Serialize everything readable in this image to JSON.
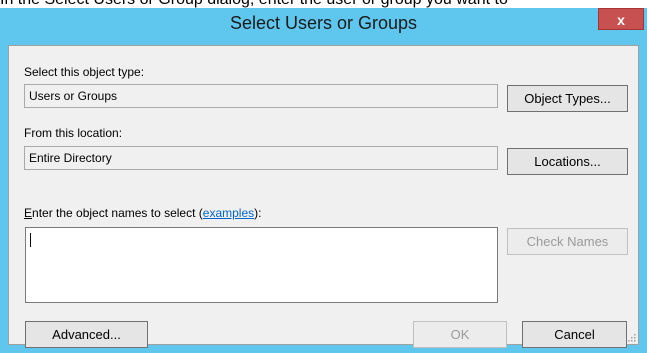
{
  "background_caption": "In the Select Users or Group dialog, enter the user or group you want to",
  "window": {
    "title": "Select Users or Groups",
    "close_glyph": "x"
  },
  "object_type": {
    "label": "Select this object type:",
    "value": "Users or Groups",
    "button": "Object Types..."
  },
  "location": {
    "label": "From this location:",
    "value": "Entire Directory",
    "button": "Locations..."
  },
  "names": {
    "label_mnemonic": "E",
    "label_prefix": "nter the object names to select (",
    "label_link": "examples",
    "label_suffix": "):",
    "value": "",
    "check_button": "Check Names"
  },
  "footer": {
    "advanced_button": "Advanced...",
    "ok_button": "OK",
    "cancel_button": "Cancel"
  },
  "colors": {
    "title_bar": "#5fc7ee",
    "close_button": "#c75050",
    "link": "#0066cc"
  },
  "icons": [
    "close-icon",
    "resize-grip-icon"
  ]
}
